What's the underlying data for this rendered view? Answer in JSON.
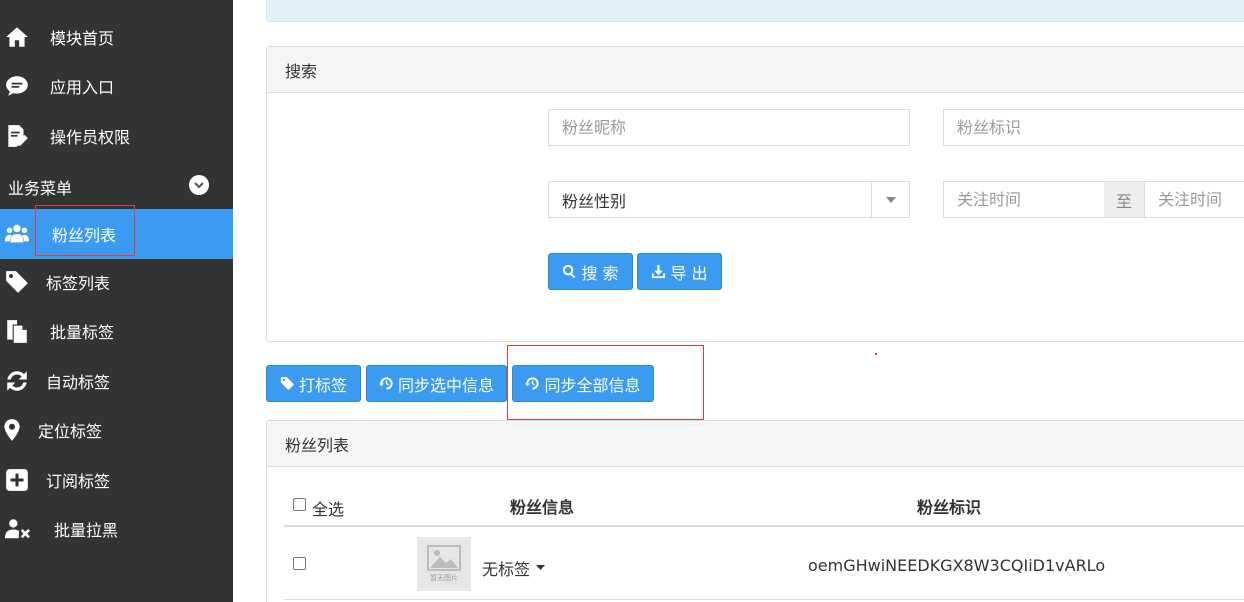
{
  "sidebar": {
    "items_top": [
      {
        "label": "模块首页",
        "icon": "home-icon"
      },
      {
        "label": "应用入口",
        "icon": "chat-icon"
      },
      {
        "label": "操作员权限",
        "icon": "edit-document-icon"
      }
    ],
    "section_title": "业务菜单",
    "section_toggle_icon": "chevron-down-icon",
    "items_menu": [
      {
        "label": "粉丝列表",
        "icon": "users-icon",
        "active": true
      },
      {
        "label": "标签列表",
        "icon": "tag-icon"
      },
      {
        "label": "批量标签",
        "icon": "copy-icon"
      },
      {
        "label": "自动标签",
        "icon": "refresh-icon"
      },
      {
        "label": "定位标签",
        "icon": "map-marker-icon"
      },
      {
        "label": "订阅标签",
        "icon": "plus-square-icon"
      },
      {
        "label": "批量拉黑",
        "icon": "user-block-icon"
      }
    ],
    "accent_color": "#3a9bf0",
    "background_color": "#333333"
  },
  "search_panel": {
    "title": "搜索",
    "nickname_placeholder": "粉丝昵称",
    "openid_placeholder": "粉丝标识",
    "gender_select": "粉丝性别",
    "follow_time_from_placeholder": "关注时间",
    "follow_time_separator": "至",
    "follow_time_to_placeholder": "关注时间",
    "search_button": "搜 索",
    "export_button": "导 出"
  },
  "toolbar": {
    "tag_button": "打标签",
    "sync_selected_button": "同步选中信息",
    "sync_all_button": "同步全部信息"
  },
  "fans_panel": {
    "title": "粉丝列表",
    "select_all_label": "全选",
    "columns": [
      "粉丝信息",
      "粉丝标识"
    ],
    "rows": [
      {
        "tag": "无标签",
        "openid": "oemGHwiNEEDKGX8W3CQIiD1vARLo",
        "avatar_caption": "暂无图片"
      }
    ]
  }
}
